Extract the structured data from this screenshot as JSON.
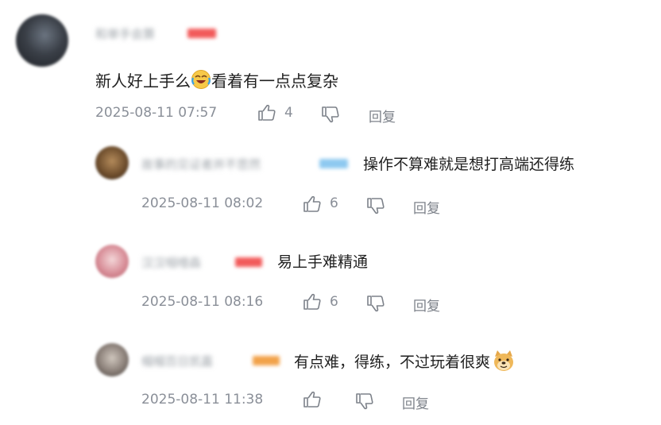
{
  "comment": {
    "author": "和单手会算",
    "text_before": "新人好上手么",
    "emoji": "laughing-tears-emoji",
    "text_after": "看着有一点点复杂",
    "time": "2025-08-11 07:57",
    "likes": "4",
    "reply_label": "回复",
    "badge_color": "#f25a5a"
  },
  "replies": [
    {
      "author": "故事的见证者并不悲然",
      "text": "操作不算难就是想打高端还得练",
      "time": "2025-08-11 08:02",
      "likes": "6",
      "reply_label": "回复",
      "badge_color": "#8ec9f0"
    },
    {
      "author": "汉汉咽噎森",
      "text": "易上手难精通",
      "time": "2025-08-11 08:16",
      "likes": "6",
      "reply_label": "回复",
      "badge_color": "#f25a5a"
    },
    {
      "author": "帽帽百日凯嘉",
      "text": "有点难，得练，不过玩着很爽",
      "emoji": "doge-emoji",
      "time": "2025-08-11 11:38",
      "likes": "",
      "reply_label": "回复",
      "badge_color": "#f2a24a"
    }
  ]
}
